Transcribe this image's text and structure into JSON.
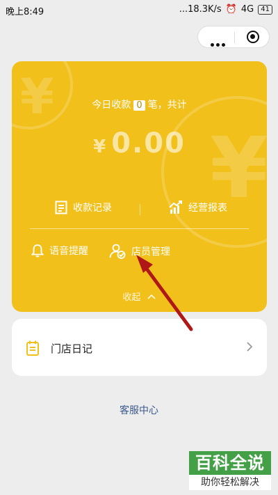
{
  "status_bar": {
    "time": "晚上8:49",
    "network_speed": "...18.3K/s",
    "signal": "4G",
    "battery": "41"
  },
  "card": {
    "today_prefix": "今日收款",
    "today_count": "0",
    "today_suffix": "笔，共计",
    "currency": "¥",
    "amount": "0.00",
    "records_label": "收款记录",
    "report_label": "经营报表",
    "voice_label": "语音提醒",
    "staff_label": "店员管理",
    "collapse_label": "收起"
  },
  "diary": {
    "label": "门店日记"
  },
  "service_label": "客服中心",
  "watermark": {
    "title": "百科全说",
    "subtitle": "助你轻松解决"
  },
  "colors": {
    "card": "#f2c01b",
    "arrow": "#b01818",
    "link": "#3b5a8c",
    "watermark": "#44a047"
  }
}
